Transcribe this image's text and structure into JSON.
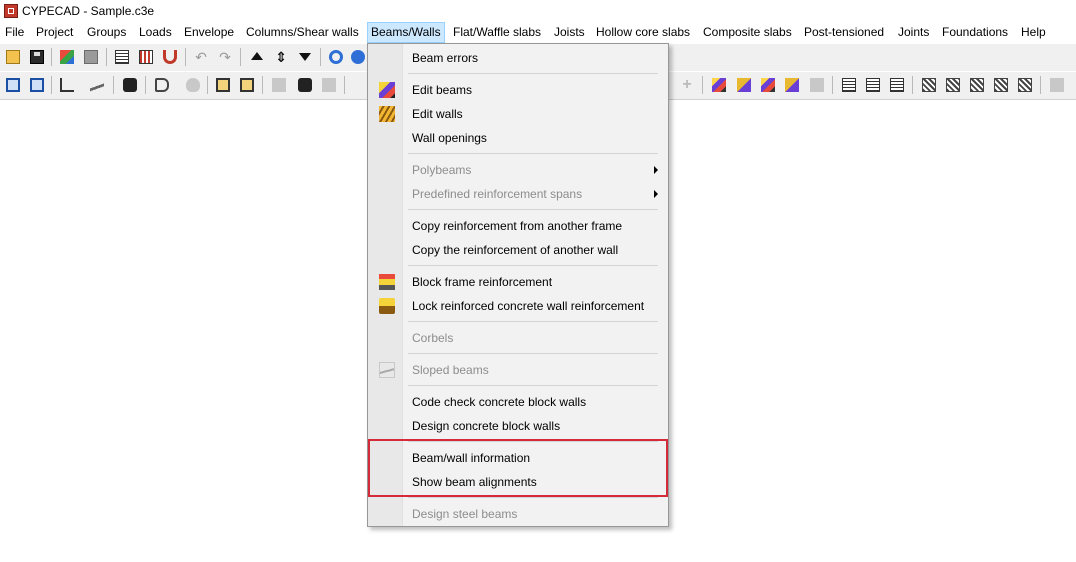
{
  "window": {
    "title": "CYPECAD - Sample.c3e"
  },
  "menubar": {
    "items": [
      {
        "label": "File"
      },
      {
        "label": "Project"
      },
      {
        "label": "Groups"
      },
      {
        "label": "Loads"
      },
      {
        "label": "Envelope"
      },
      {
        "label": "Columns/Shear walls"
      },
      {
        "label": "Beams/Walls",
        "active": true
      },
      {
        "label": "Flat/Waffle slabs"
      },
      {
        "label": "Joists"
      },
      {
        "label": "Hollow core slabs"
      },
      {
        "label": "Composite slabs"
      },
      {
        "label": "Post-tensioned"
      },
      {
        "label": "Joints"
      },
      {
        "label": "Foundations"
      },
      {
        "label": "Help"
      }
    ]
  },
  "toolbar1": {
    "icons": [
      "open-folder-icon",
      "save-disk-icon",
      "paint-icon",
      "column-icon",
      "dxf-grid-icon",
      "grid-icon",
      "magnet-icon",
      "undo-icon",
      "redo-icon",
      "up-arrow-icon",
      "up-down-arrow-icon",
      "down-arrow-icon",
      "rotate-icon",
      "snap-icon"
    ]
  },
  "toolbar2": {
    "icons": [
      "frame-view-icon",
      "3d-view-icon",
      "stairs-icon",
      "slope-icon",
      "phone-icon",
      "tag-icon",
      "fire-icon",
      "box-icon",
      "box2-icon",
      "edit-icon",
      "help-icon",
      "settings-icon",
      "beam-color-icon",
      "wall-color-icon",
      "block-icon",
      "lock-icon",
      "sloped-icon",
      "grid-a-icon",
      "grid-b-icon",
      "grid-c-icon",
      "checker-a-icon",
      "checker-b-icon",
      "checker-c-icon",
      "cross-icon",
      "cross2-icon",
      "settings-right-icon"
    ]
  },
  "dropdown": {
    "items": [
      {
        "label": "Beam errors",
        "disabled": false,
        "icon": ""
      },
      {
        "label": "Edit beams",
        "disabled": false,
        "icon": "edit-beams-icon"
      },
      {
        "label": "Edit walls",
        "disabled": false,
        "icon": "edit-walls-icon"
      },
      {
        "label": "Wall openings",
        "disabled": false,
        "icon": ""
      },
      {
        "label": "Polybeams",
        "disabled": true,
        "icon": "",
        "submenu": true
      },
      {
        "label": "Predefined reinforcement spans",
        "disabled": true,
        "icon": "",
        "submenu": true
      },
      {
        "label": "Copy reinforcement from another frame",
        "disabled": false,
        "icon": ""
      },
      {
        "label": "Copy the reinforcement of another wall",
        "disabled": false,
        "icon": ""
      },
      {
        "label": "Block frame reinforcement",
        "disabled": false,
        "icon": "block-frame-icon"
      },
      {
        "label": "Lock reinforced concrete wall reinforcement",
        "disabled": false,
        "icon": "lock-wall-icon"
      },
      {
        "label": "Corbels",
        "disabled": true,
        "icon": ""
      },
      {
        "label": "Sloped beams",
        "disabled": true,
        "icon": "sloped-beams-icon"
      },
      {
        "label": "Code check concrete block walls",
        "disabled": false,
        "icon": ""
      },
      {
        "label": "Design concrete block walls",
        "disabled": false,
        "icon": ""
      },
      {
        "label": "Beam/wall information",
        "disabled": false,
        "icon": ""
      },
      {
        "label": "Show beam alignments",
        "disabled": false,
        "icon": ""
      },
      {
        "label": "Design steel beams",
        "disabled": true,
        "icon": ""
      }
    ]
  },
  "colors": {
    "highlight_border": "#d42b3a",
    "active_menu_bg": "#cce8ff",
    "disabled_text": "#8d8d8d"
  }
}
